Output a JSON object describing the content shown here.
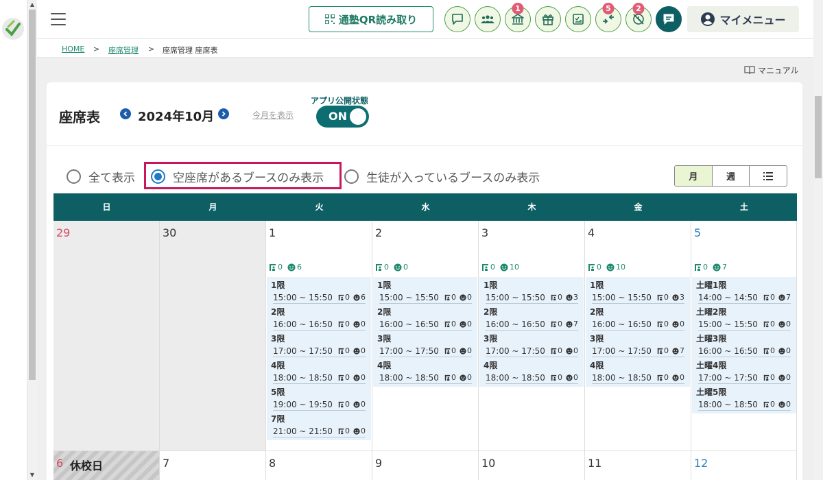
{
  "header": {
    "qr_label": "通塾QR読み取り",
    "badges": {
      "school": "1",
      "transfer": "5",
      "absence": "2"
    },
    "my_menu": "マイメニュー"
  },
  "breadcrumb": [
    "HOME",
    "座席管理",
    "座席管理 座席表"
  ],
  "breadcrumb_sep": ">",
  "manual_label": "マニュアル",
  "page": {
    "title": "座席表",
    "month": "2024年10月",
    "this_month_link": "今月を表示",
    "publish_label": "アプリ公開状態",
    "publish_value": "ON"
  },
  "filters": [
    {
      "label": "全て表示",
      "checked": false
    },
    {
      "label": "空座席があるブースのみ表示",
      "checked": true
    },
    {
      "label": "生徒が入っているブースのみ表示",
      "checked": false
    }
  ],
  "view_modes": [
    "月",
    "週",
    "list-icon"
  ],
  "weekdays": [
    "日",
    "月",
    "火",
    "水",
    "木",
    "金",
    "土"
  ],
  "colors": {
    "teal": "#0d5f64",
    "green": "#1e8a6e",
    "highlight": "#c8175d",
    "sunday": "#d9475f",
    "saturday": "#2a7fb8"
  },
  "week1": [
    {
      "day": "29",
      "type": "sun",
      "gray": true
    },
    {
      "day": "30",
      "type": "",
      "gray": true
    },
    {
      "day": "1",
      "type": "",
      "seats": "0",
      "students": "6",
      "slots": [
        {
          "name": "1限",
          "time": "15:00 ~ 15:50",
          "seats": "0",
          "students": "6"
        },
        {
          "name": "2限",
          "time": "16:00 ~ 16:50",
          "seats": "0",
          "students": "0"
        },
        {
          "name": "3限",
          "time": "17:00 ~ 17:50",
          "seats": "0",
          "students": "0"
        },
        {
          "name": "4限",
          "time": "18:00 ~ 18:50",
          "seats": "0",
          "students": "0"
        },
        {
          "name": "5限",
          "time": "19:00 ~ 19:50",
          "seats": "0",
          "students": "0"
        },
        {
          "name": "7限",
          "time": "21:00 ~ 21:50",
          "seats": "0",
          "students": "0"
        }
      ]
    },
    {
      "day": "2",
      "type": "",
      "seats": "0",
      "students": "0",
      "slots": [
        {
          "name": "1限",
          "time": "15:00 ~ 15:50",
          "seats": "0",
          "students": "0"
        },
        {
          "name": "2限",
          "time": "16:00 ~ 16:50",
          "seats": "0",
          "students": "0"
        },
        {
          "name": "3限",
          "time": "17:00 ~ 17:50",
          "seats": "0",
          "students": "0"
        },
        {
          "name": "4限",
          "time": "18:00 ~ 18:50",
          "seats": "0",
          "students": "0"
        }
      ]
    },
    {
      "day": "3",
      "type": "",
      "seats": "0",
      "students": "10",
      "slots": [
        {
          "name": "1限",
          "time": "15:00 ~ 15:50",
          "seats": "0",
          "students": "3"
        },
        {
          "name": "2限",
          "time": "16:00 ~ 16:50",
          "seats": "0",
          "students": "7"
        },
        {
          "name": "3限",
          "time": "17:00 ~ 17:50",
          "seats": "0",
          "students": "0"
        },
        {
          "name": "4限",
          "time": "18:00 ~ 18:50",
          "seats": "0",
          "students": "0"
        }
      ]
    },
    {
      "day": "4",
      "type": "",
      "seats": "0",
      "students": "10",
      "slots": [
        {
          "name": "1限",
          "time": "15:00 ~ 15:50",
          "seats": "0",
          "students": "3"
        },
        {
          "name": "2限",
          "time": "16:00 ~ 16:50",
          "seats": "0",
          "students": "0"
        },
        {
          "name": "3限",
          "time": "17:00 ~ 17:50",
          "seats": "0",
          "students": "7"
        },
        {
          "name": "4限",
          "time": "18:00 ~ 18:50",
          "seats": "0",
          "students": "0"
        }
      ]
    },
    {
      "day": "5",
      "type": "sat",
      "seats": "0",
      "students": "7",
      "slots": [
        {
          "name": "土曜1限",
          "time": "14:00 ~ 14:50",
          "seats": "0",
          "students": "7"
        },
        {
          "name": "土曜2限",
          "time": "15:00 ~ 15:50",
          "seats": "0",
          "students": "0"
        },
        {
          "name": "土曜3限",
          "time": "16:00 ~ 16:50",
          "seats": "0",
          "students": "0"
        },
        {
          "name": "土曜4限",
          "time": "17:00 ~ 17:50",
          "seats": "0",
          "students": "0"
        },
        {
          "name": "土曜5限",
          "time": "18:00 ~ 18:50",
          "seats": "0",
          "students": "0"
        }
      ]
    }
  ],
  "week2": [
    {
      "day": "6",
      "type": "sun",
      "holiday": "休校日"
    },
    {
      "day": "7",
      "type": ""
    },
    {
      "day": "8",
      "type": ""
    },
    {
      "day": "9",
      "type": ""
    },
    {
      "day": "10",
      "type": ""
    },
    {
      "day": "11",
      "type": ""
    },
    {
      "day": "12",
      "type": "sat"
    }
  ]
}
